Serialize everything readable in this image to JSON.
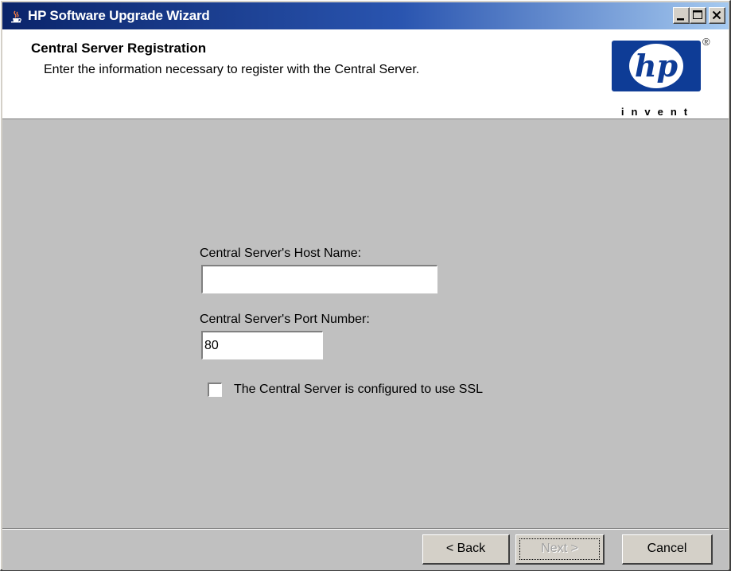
{
  "window": {
    "title": "HP Software Upgrade Wizard",
    "app_icon": "java-cup-icon",
    "controls": [
      "minimize-icon",
      "maximize-icon",
      "close-icon"
    ]
  },
  "header": {
    "title": "Central Server Registration",
    "subtitle": "Enter the information necessary to register with the Central Server.",
    "logo": {
      "brand": "hp",
      "tagline": "invent",
      "registered_mark": "®"
    }
  },
  "form": {
    "host_label": "Central Server's Host Name:",
    "host_value": "",
    "port_label": "Central Server's Port Number:",
    "port_value": "80",
    "ssl_label": "The Central Server is configured to use SSL",
    "ssl_checked": false
  },
  "buttons": {
    "back": "< Back",
    "next": "Next >",
    "cancel": "Cancel"
  },
  "colors": {
    "titlebar_start": "#0a246a",
    "titlebar_end": "#a6caf0",
    "hp_blue": "#0e3c96",
    "panel": "#c0c0c0"
  }
}
